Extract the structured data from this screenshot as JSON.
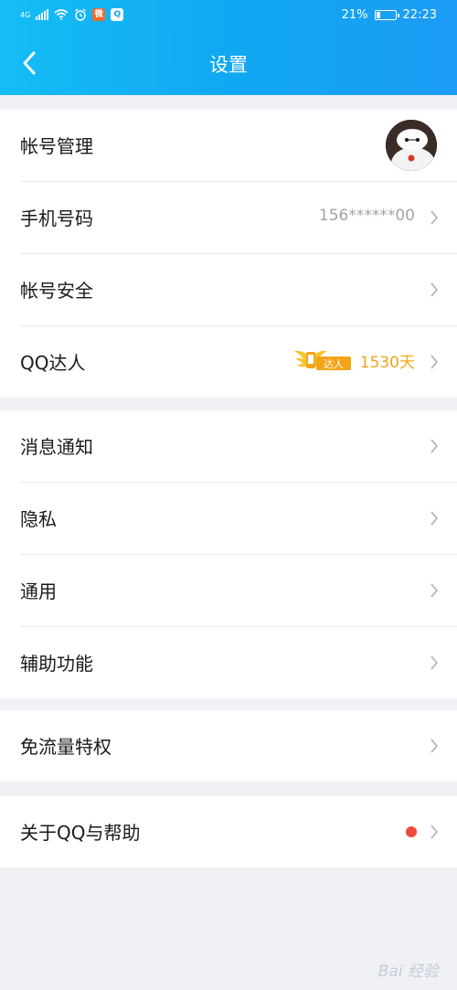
{
  "status_bar": {
    "network": "4G",
    "battery": "21%",
    "battery_level": 0.21,
    "time": "22:23"
  },
  "header": {
    "title": "设置"
  },
  "groups": [
    {
      "items": [
        {
          "label": "帐号管理",
          "icon": "avatar-baymax"
        },
        {
          "label": "手机号码",
          "value": "156******00"
        },
        {
          "label": "帐号安全"
        },
        {
          "label": "QQ达人",
          "badge_text": "达人",
          "days": "1530天"
        }
      ]
    },
    {
      "items": [
        {
          "label": "消息通知"
        },
        {
          "label": "隐私"
        },
        {
          "label": "通用"
        },
        {
          "label": "辅助功能"
        }
      ]
    },
    {
      "items": [
        {
          "label": "免流量特权"
        }
      ]
    },
    {
      "items": [
        {
          "label": "关于QQ与帮助",
          "has_red_dot": true
        }
      ]
    }
  ],
  "colors": {
    "header_start": "#15bdf5",
    "header_end": "#1c9cf5",
    "background": "#eff1f5",
    "accent_gold": "#f2a518",
    "red_dot": "#f04b3a"
  },
  "watermark": "Bai 经验"
}
